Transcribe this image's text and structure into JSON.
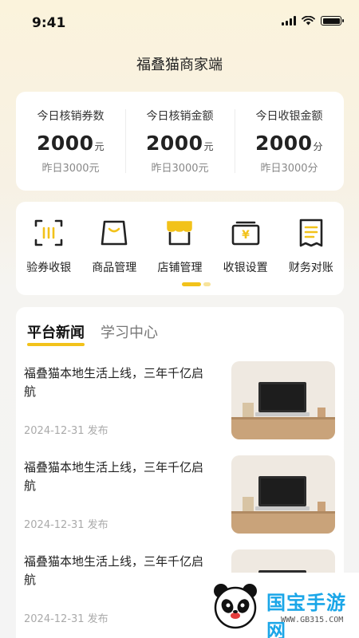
{
  "status_bar": {
    "time": "9:41"
  },
  "app_title": "福叠猫商家端",
  "stats": [
    {
      "label": "今日核销券数",
      "value": "2000",
      "unit": "元",
      "previous": "昨日3000元"
    },
    {
      "label": "今日核销金额",
      "value": "2000",
      "unit": "元",
      "previous": "昨日3000元"
    },
    {
      "label": "今日收银金额",
      "value": "2000",
      "unit": "分",
      "previous": "昨日3000分"
    }
  ],
  "menu": [
    {
      "label": "验券收银",
      "icon": "scan-coupon-icon"
    },
    {
      "label": "商品管理",
      "icon": "shopping-bag-icon"
    },
    {
      "label": "店铺管理",
      "icon": "storefront-icon"
    },
    {
      "label": "收银设置",
      "icon": "cashier-icon"
    },
    {
      "label": "财务对账",
      "icon": "receipt-icon"
    }
  ],
  "tabs": [
    {
      "label": "平台新闻",
      "active": true
    },
    {
      "label": "学习中心",
      "active": false
    }
  ],
  "news": [
    {
      "title": "福叠猫本地生活上线，三年千亿启航",
      "date": "2024-12-31 发布"
    },
    {
      "title": "福叠猫本地生活上线，三年千亿启航",
      "date": "2024-12-31 发布"
    },
    {
      "title": "福叠猫本地生活上线，三年千亿启航",
      "date": "2024-12-31 发布"
    }
  ],
  "watermark": {
    "text": "国宝手游网",
    "sub": "WWW.GB315.COM"
  },
  "colors": {
    "accent": "#f2c21a",
    "watermark_blue": "#1aa6e8"
  }
}
